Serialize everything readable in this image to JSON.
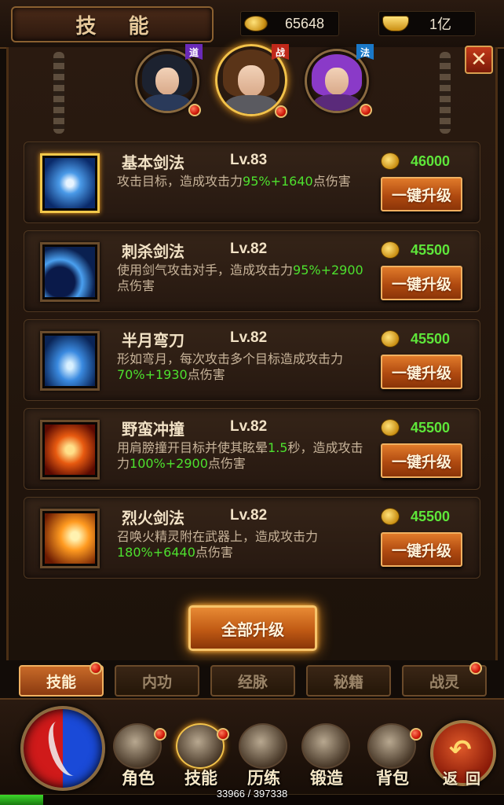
{
  "header": {
    "title": "技 能",
    "gold": "65648",
    "ingots": "1亿"
  },
  "characters": [
    {
      "class_tag": "道",
      "class_color": "#6a2ab8",
      "selected": false,
      "notify": true
    },
    {
      "class_tag": "战",
      "class_color": "#c0281a",
      "selected": true,
      "notify": true
    },
    {
      "class_tag": "法",
      "class_color": "#1a78c8",
      "selected": false,
      "notify": true
    }
  ],
  "skills": [
    {
      "name": "基本剑法",
      "level": "Lv.83",
      "desc_a": "攻击目标，造成攻击力",
      "desc_g1": "95%+1640",
      "desc_b": "点伤害",
      "cost": "46000",
      "button": "一键升级",
      "selected": true,
      "icon": "sword-slash-icon"
    },
    {
      "name": "刺杀剑法",
      "level": "Lv.82",
      "desc_a": "使用剑气攻击对手，造成攻击力",
      "desc_g1": "95%+2900",
      "desc_b": "点伤害",
      "cost": "45500",
      "button": "一键升级",
      "selected": false,
      "icon": "crescent-thrust-icon"
    },
    {
      "name": "半月弯刀",
      "level": "Lv.82",
      "desc_a": "形如弯月，每次攻击多个目标造成攻击力",
      "desc_g1": "70%+1930",
      "desc_b": "点伤害",
      "cost": "45500",
      "button": "一键升级",
      "selected": false,
      "icon": "half-moon-blade-icon"
    },
    {
      "name": "野蛮冲撞",
      "level": "Lv.82",
      "desc_a": "用肩膀撞开目标并使其眩晕",
      "desc_g0": "1.5",
      "desc_m": "秒，造成攻击力",
      "desc_g1": "100%+2900",
      "desc_b": "点伤害",
      "cost": "45500",
      "button": "一键升级",
      "selected": false,
      "icon": "charge-runner-icon"
    },
    {
      "name": "烈火剑法",
      "level": "Lv.82",
      "desc_a": "召唤火精灵附在武器上，造成攻击力",
      "desc_g1": "180%+6440",
      "desc_b": "点伤害",
      "cost": "45500",
      "button": "一键升级",
      "selected": false,
      "icon": "fire-sword-icon"
    }
  ],
  "upgrade_all": "全部升级",
  "subtabs": [
    {
      "label": "技能",
      "active": true,
      "notify": true
    },
    {
      "label": "内功",
      "active": false,
      "notify": false
    },
    {
      "label": "经脉",
      "active": false,
      "notify": false
    },
    {
      "label": "秘籍",
      "active": false,
      "notify": false
    },
    {
      "label": "战灵",
      "active": false,
      "notify": true
    }
  ],
  "nav": [
    {
      "label": "角色",
      "icon": "armor-character-icon",
      "active": false,
      "notify": true
    },
    {
      "label": "技能",
      "icon": "skill-scroll-icon",
      "active": true,
      "notify": true
    },
    {
      "label": "历练",
      "icon": "helmet-training-icon",
      "active": false,
      "notify": false
    },
    {
      "label": "锻造",
      "icon": "anvil-forge-icon",
      "active": false,
      "notify": false
    },
    {
      "label": "背包",
      "icon": "backpack-icon",
      "active": false,
      "notify": true
    }
  ],
  "back_label": "返回",
  "exp": {
    "text": "33966 / 397338",
    "fraction": 0.0855
  }
}
